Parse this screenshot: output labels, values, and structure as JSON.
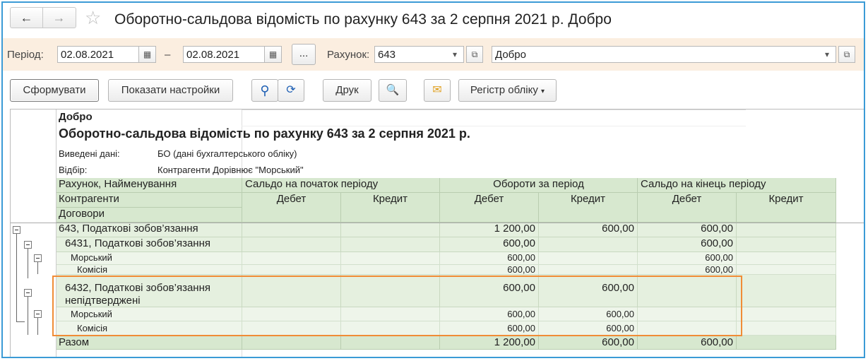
{
  "window": {
    "title": "Оборотно-сальдова відомість по рахунку 643 за 2 серпня 2021 р. Добро",
    "back_icon": "←",
    "forward_icon": "→",
    "star_icon": "☆"
  },
  "filters": {
    "period_label": "Період:",
    "date_from": "02.08.2021",
    "dash": "–",
    "date_to": "02.08.2021",
    "ellipsis_label": "...",
    "account_label": "Рахунок:",
    "account_value": "643",
    "organization_value": "Добро"
  },
  "toolbar": {
    "generate_label": "Сформувати",
    "show_settings_label": "Показати настройки",
    "print_label": "Друк",
    "register_label": "Регістр обліку"
  },
  "report": {
    "org": "Добро",
    "title": "Оборотно-сальдова відомість по рахунку 643 за 2 серпня 2021 р.",
    "data_label": "Виведені дані:",
    "data_value": "БО (дані бухгалтерського обліку)",
    "filter_label": "Відбір:",
    "filter_value": "Контрагенти Дорівнює \"Морський\"",
    "headers": {
      "account": "Рахунок, Найменування",
      "counterparties": "Контрагенти",
      "contracts": "Договори",
      "opening": "Сальдо на початок періоду",
      "turnover": "Обороти за період",
      "closing": "Сальдо на кінець періоду",
      "debit": "Дебет",
      "credit": "Кредит"
    },
    "rows": [
      {
        "name": "643, Податкові зобов’язання",
        "od": "",
        "oc": "",
        "td": "1 200,00",
        "tc": "600,00",
        "cd": "600,00",
        "cc": ""
      },
      {
        "name": "6431, Податкові зобов’язання",
        "od": "",
        "oc": "",
        "td": "600,00",
        "tc": "",
        "cd": "600,00",
        "cc": ""
      },
      {
        "name": "Морський",
        "od": "",
        "oc": "",
        "td": "600,00",
        "tc": "",
        "cd": "600,00",
        "cc": ""
      },
      {
        "name": "Комісія",
        "od": "",
        "oc": "",
        "td": "600,00",
        "tc": "",
        "cd": "600,00",
        "cc": ""
      },
      {
        "name": "6432, Податкові зобов’язання непідтверджені",
        "name_line1": "6432, Податкові зобов’язання",
        "name_line2": "непідтверджені",
        "od": "",
        "oc": "",
        "td": "600,00",
        "tc": "600,00",
        "cd": "",
        "cc": ""
      },
      {
        "name": "Морський",
        "od": "",
        "oc": "",
        "td": "600,00",
        "tc": "600,00",
        "cd": "",
        "cc": ""
      },
      {
        "name": "Комісія",
        "od": "",
        "oc": "",
        "td": "600,00",
        "tc": "600,00",
        "cd": "",
        "cc": ""
      }
    ],
    "total": {
      "name": "Разом",
      "od": "",
      "oc": "",
      "td": "1 200,00",
      "tc": "600,00",
      "cd": "600,00",
      "cc": ""
    }
  },
  "colors": {
    "header_green": "#d7e8cf",
    "filter_bar": "#fbeee0",
    "highlight_border": "#f08c36",
    "window_border": "#3b9bd6"
  }
}
